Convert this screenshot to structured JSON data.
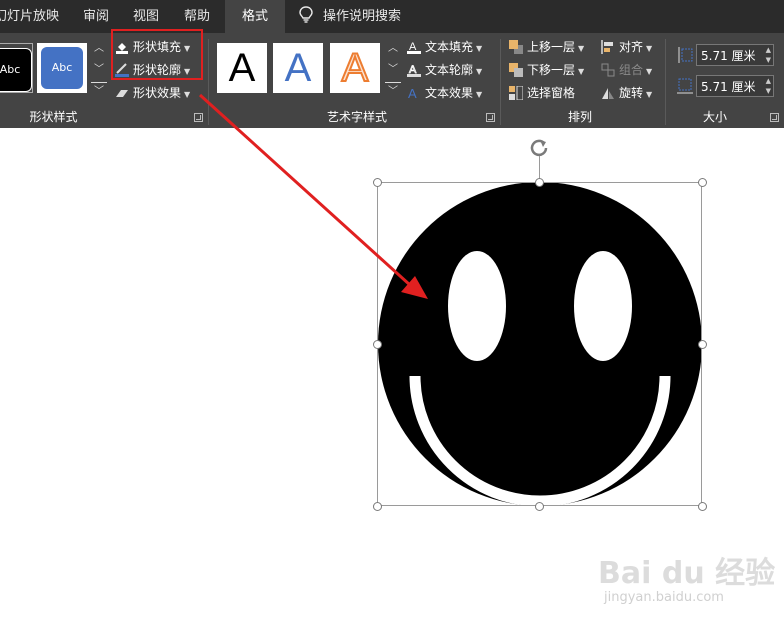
{
  "tabs": {
    "slideshow": "幻灯片放映",
    "review": "审阅",
    "view": "视图",
    "help": "帮助",
    "format": "格式",
    "tell_me": "操作说明搜索"
  },
  "shape_styles": {
    "swatch1_text": "Abc",
    "swatch2_text": "Abc",
    "fill_label": "形状填充",
    "outline_label": "形状轮廓",
    "effects_label": "形状效果",
    "group_label": "形状样式"
  },
  "wordart": {
    "sample": "A",
    "text_fill": "文本填充",
    "text_outline": "文本轮廓",
    "text_effects": "文本效果",
    "group_label": "艺术字样式"
  },
  "arrange": {
    "bring_forward": "上移一层",
    "send_backward": "下移一层",
    "selection_pane": "选择窗格",
    "align": "对齐",
    "group": "组合",
    "rotate": "旋转",
    "group_label": "排列"
  },
  "size": {
    "height_value": "5.71 厘米",
    "width_value": "5.71 厘米",
    "group_label": "大小"
  },
  "watermark": {
    "logo": "Bai du 经验",
    "url": "jingyan.baidu.com"
  },
  "colors": {
    "ribbon_bg": "#444444",
    "tabbar_bg": "#2b2b2b",
    "highlight_red": "#e02020",
    "accent_blue": "#4472c4",
    "wordart_orange": "#ed7d31"
  }
}
